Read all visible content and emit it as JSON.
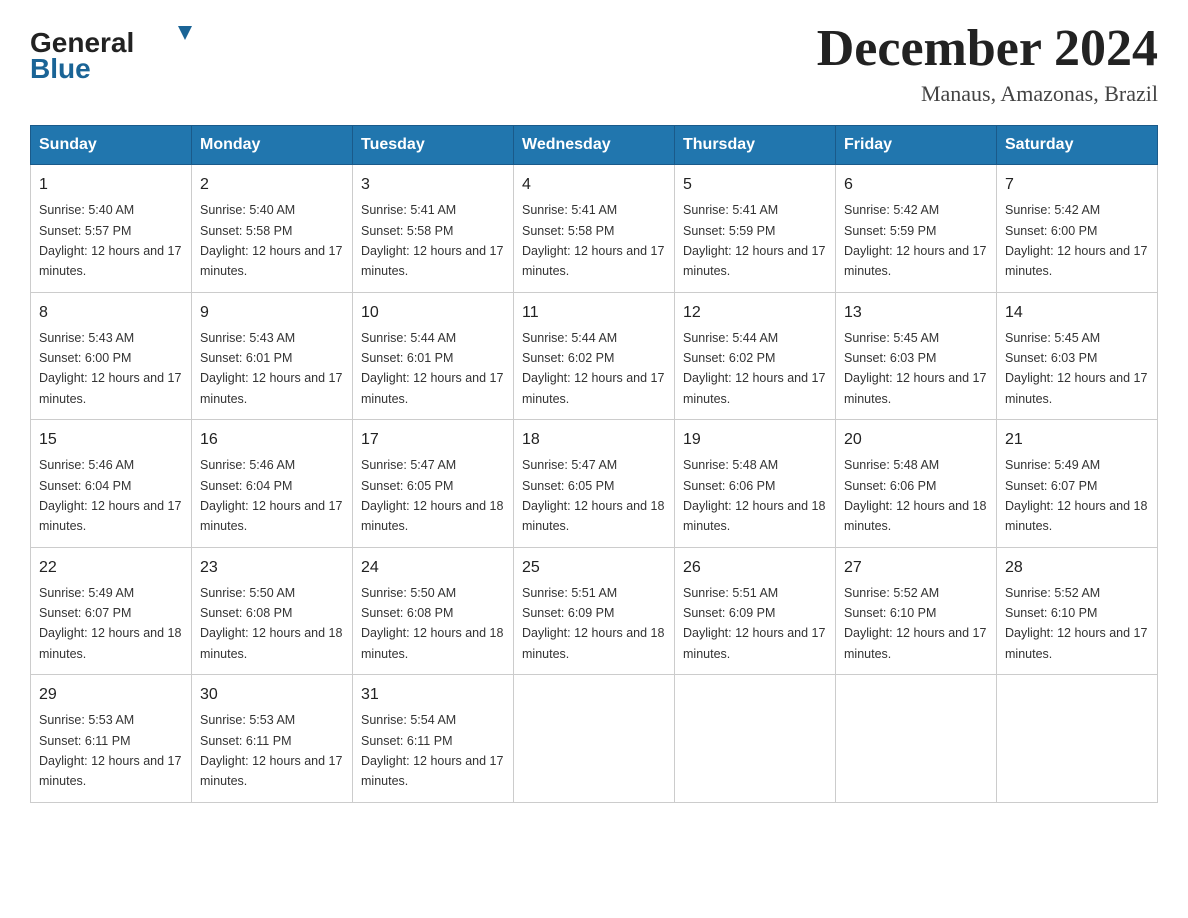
{
  "header": {
    "logo_general": "General",
    "logo_blue": "Blue",
    "month_title": "December 2024",
    "location": "Manaus, Amazonas, Brazil"
  },
  "calendar": {
    "days_of_week": [
      "Sunday",
      "Monday",
      "Tuesday",
      "Wednesday",
      "Thursday",
      "Friday",
      "Saturday"
    ],
    "weeks": [
      [
        {
          "day": "1",
          "sunrise": "5:40 AM",
          "sunset": "5:57 PM",
          "daylight": "12 hours and 17 minutes."
        },
        {
          "day": "2",
          "sunrise": "5:40 AM",
          "sunset": "5:58 PM",
          "daylight": "12 hours and 17 minutes."
        },
        {
          "day": "3",
          "sunrise": "5:41 AM",
          "sunset": "5:58 PM",
          "daylight": "12 hours and 17 minutes."
        },
        {
          "day": "4",
          "sunrise": "5:41 AM",
          "sunset": "5:58 PM",
          "daylight": "12 hours and 17 minutes."
        },
        {
          "day": "5",
          "sunrise": "5:41 AM",
          "sunset": "5:59 PM",
          "daylight": "12 hours and 17 minutes."
        },
        {
          "day": "6",
          "sunrise": "5:42 AM",
          "sunset": "5:59 PM",
          "daylight": "12 hours and 17 minutes."
        },
        {
          "day": "7",
          "sunrise": "5:42 AM",
          "sunset": "6:00 PM",
          "daylight": "12 hours and 17 minutes."
        }
      ],
      [
        {
          "day": "8",
          "sunrise": "5:43 AM",
          "sunset": "6:00 PM",
          "daylight": "12 hours and 17 minutes."
        },
        {
          "day": "9",
          "sunrise": "5:43 AM",
          "sunset": "6:01 PM",
          "daylight": "12 hours and 17 minutes."
        },
        {
          "day": "10",
          "sunrise": "5:44 AM",
          "sunset": "6:01 PM",
          "daylight": "12 hours and 17 minutes."
        },
        {
          "day": "11",
          "sunrise": "5:44 AM",
          "sunset": "6:02 PM",
          "daylight": "12 hours and 17 minutes."
        },
        {
          "day": "12",
          "sunrise": "5:44 AM",
          "sunset": "6:02 PM",
          "daylight": "12 hours and 17 minutes."
        },
        {
          "day": "13",
          "sunrise": "5:45 AM",
          "sunset": "6:03 PM",
          "daylight": "12 hours and 17 minutes."
        },
        {
          "day": "14",
          "sunrise": "5:45 AM",
          "sunset": "6:03 PM",
          "daylight": "12 hours and 17 minutes."
        }
      ],
      [
        {
          "day": "15",
          "sunrise": "5:46 AM",
          "sunset": "6:04 PM",
          "daylight": "12 hours and 17 minutes."
        },
        {
          "day": "16",
          "sunrise": "5:46 AM",
          "sunset": "6:04 PM",
          "daylight": "12 hours and 17 minutes."
        },
        {
          "day": "17",
          "sunrise": "5:47 AM",
          "sunset": "6:05 PM",
          "daylight": "12 hours and 18 minutes."
        },
        {
          "day": "18",
          "sunrise": "5:47 AM",
          "sunset": "6:05 PM",
          "daylight": "12 hours and 18 minutes."
        },
        {
          "day": "19",
          "sunrise": "5:48 AM",
          "sunset": "6:06 PM",
          "daylight": "12 hours and 18 minutes."
        },
        {
          "day": "20",
          "sunrise": "5:48 AM",
          "sunset": "6:06 PM",
          "daylight": "12 hours and 18 minutes."
        },
        {
          "day": "21",
          "sunrise": "5:49 AM",
          "sunset": "6:07 PM",
          "daylight": "12 hours and 18 minutes."
        }
      ],
      [
        {
          "day": "22",
          "sunrise": "5:49 AM",
          "sunset": "6:07 PM",
          "daylight": "12 hours and 18 minutes."
        },
        {
          "day": "23",
          "sunrise": "5:50 AM",
          "sunset": "6:08 PM",
          "daylight": "12 hours and 18 minutes."
        },
        {
          "day": "24",
          "sunrise": "5:50 AM",
          "sunset": "6:08 PM",
          "daylight": "12 hours and 18 minutes."
        },
        {
          "day": "25",
          "sunrise": "5:51 AM",
          "sunset": "6:09 PM",
          "daylight": "12 hours and 18 minutes."
        },
        {
          "day": "26",
          "sunrise": "5:51 AM",
          "sunset": "6:09 PM",
          "daylight": "12 hours and 17 minutes."
        },
        {
          "day": "27",
          "sunrise": "5:52 AM",
          "sunset": "6:10 PM",
          "daylight": "12 hours and 17 minutes."
        },
        {
          "day": "28",
          "sunrise": "5:52 AM",
          "sunset": "6:10 PM",
          "daylight": "12 hours and 17 minutes."
        }
      ],
      [
        {
          "day": "29",
          "sunrise": "5:53 AM",
          "sunset": "6:11 PM",
          "daylight": "12 hours and 17 minutes."
        },
        {
          "day": "30",
          "sunrise": "5:53 AM",
          "sunset": "6:11 PM",
          "daylight": "12 hours and 17 minutes."
        },
        {
          "day": "31",
          "sunrise": "5:54 AM",
          "sunset": "6:11 PM",
          "daylight": "12 hours and 17 minutes."
        },
        null,
        null,
        null,
        null
      ]
    ]
  }
}
